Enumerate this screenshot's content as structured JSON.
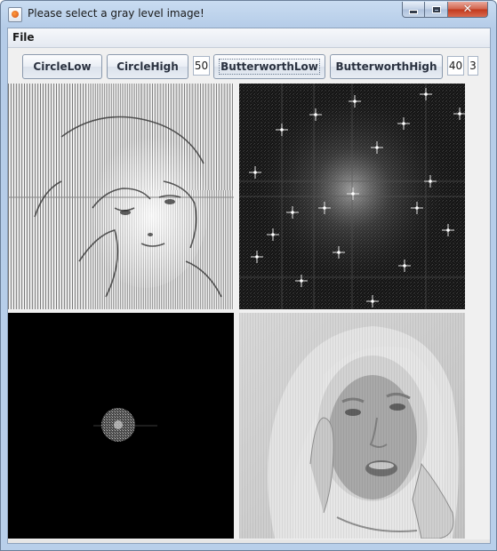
{
  "window": {
    "title": "Please select a gray level image!",
    "controls": {
      "minimize": "minimize-icon",
      "maximize": "maximize-icon",
      "close": "close-icon"
    }
  },
  "menubar": {
    "items": [
      "File"
    ]
  },
  "toolbar": {
    "buttons": [
      "CircleLow",
      "CircleHigh",
      "ButterworthLow",
      "ButterworthHigh"
    ],
    "circle_radius": "50",
    "butterworth_cutoff": "40",
    "butterworth_order": "3"
  },
  "panels": {
    "top_left": "edge-enhanced-face-image",
    "top_right": "fourier-spectrum-image",
    "bottom_left": "filtered-spectrum-image",
    "bottom_right": "filtered-face-image"
  },
  "colors": {
    "accent": "#b8cfea",
    "client_bg": "#f0f0f0",
    "close_button": "#c2381c"
  }
}
